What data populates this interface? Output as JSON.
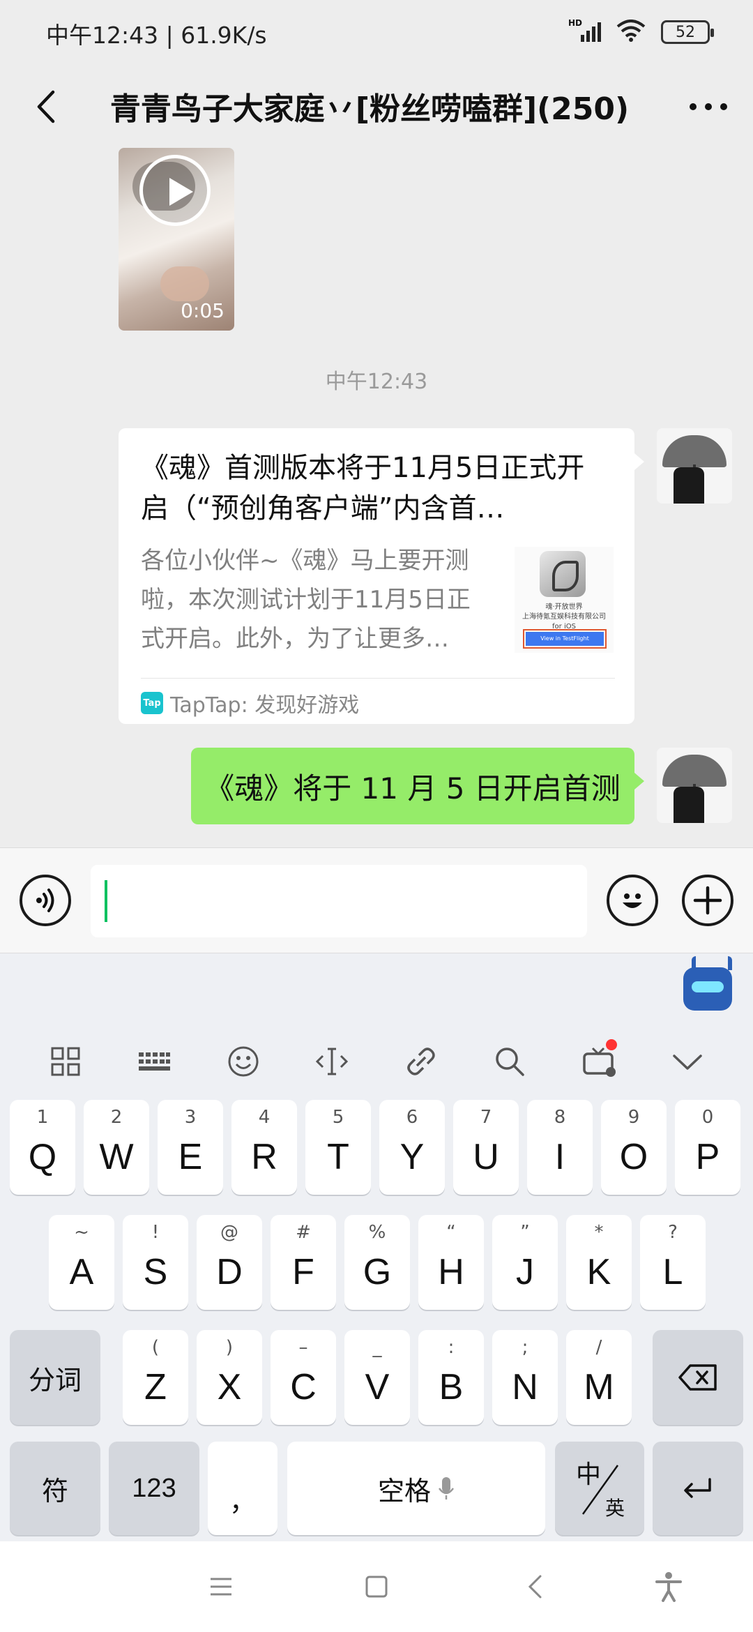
{
  "status_bar": {
    "time_speed": "中午12:43 | 61.9K/s",
    "network": "HD",
    "battery": "52"
  },
  "nav": {
    "title": "青青鸟子大家庭丷[粉丝唠嗑群](250)"
  },
  "messages": {
    "video": {
      "duration": "0:05"
    },
    "timestamp": "中午12:43",
    "link_card": {
      "title": "《魂》首测版本将于11月5日正式开启（“预创角客户端”内含首…",
      "description": "各位小伙伴~《魂》马上要开测啦，本次测试计划于11月5日正式开启。此外，为了让更多…",
      "thumb_line1": "魂·开放世界",
      "thumb_line2": "上海待氪互娱科技有限公司 for iOS",
      "thumb_button": "View in TestFlight",
      "source_icon": "Tap",
      "source": "TapTap: 发现好游戏"
    },
    "text": "《魂》将于 11 月 5 日开启首测"
  },
  "input": {
    "value": ""
  },
  "keyboard": {
    "row1": [
      {
        "hint": "1",
        "key": "Q"
      },
      {
        "hint": "2",
        "key": "W"
      },
      {
        "hint": "3",
        "key": "E"
      },
      {
        "hint": "4",
        "key": "R"
      },
      {
        "hint": "5",
        "key": "T"
      },
      {
        "hint": "6",
        "key": "Y"
      },
      {
        "hint": "7",
        "key": "U"
      },
      {
        "hint": "8",
        "key": "I"
      },
      {
        "hint": "9",
        "key": "O"
      },
      {
        "hint": "0",
        "key": "P"
      }
    ],
    "row2": [
      {
        "hint": "~",
        "key": "A"
      },
      {
        "hint": "!",
        "key": "S"
      },
      {
        "hint": "@",
        "key": "D"
      },
      {
        "hint": "#",
        "key": "F"
      },
      {
        "hint": "%",
        "key": "G"
      },
      {
        "hint": "“",
        "key": "H"
      },
      {
        "hint": "”",
        "key": "J"
      },
      {
        "hint": "*",
        "key": "K"
      },
      {
        "hint": "?",
        "key": "L"
      }
    ],
    "row3": [
      {
        "hint": "(",
        "key": "Z"
      },
      {
        "hint": ")",
        "key": "X"
      },
      {
        "hint": "–",
        "key": "C"
      },
      {
        "hint": "_",
        "key": "V"
      },
      {
        "hint": ":",
        "key": "B"
      },
      {
        "hint": ";",
        "key": "N"
      },
      {
        "hint": "/",
        "key": "M"
      }
    ],
    "fenci": "分词",
    "fu": "符",
    "num": "123",
    "comma": "，",
    "space": "空格",
    "period": "。",
    "lang_top": "中",
    "lang_bottom": "英"
  },
  "colors": {
    "bubble_green": "#95ec69",
    "caret": "#07c160",
    "taptap": "#19c3ce"
  }
}
